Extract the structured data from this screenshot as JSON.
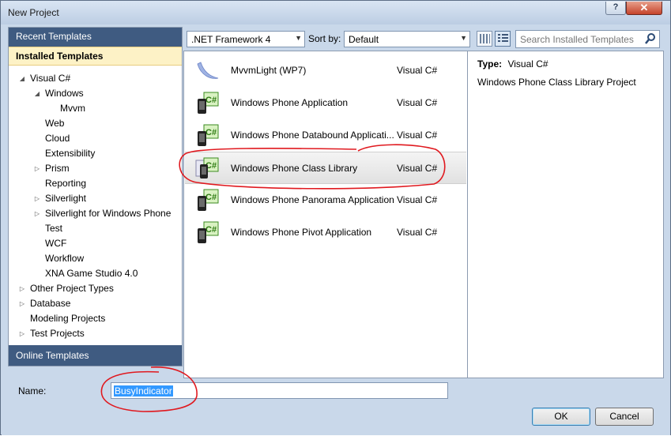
{
  "window": {
    "title": "New Project",
    "help_label": "?",
    "close_label": "✕"
  },
  "left": {
    "recent_templates": "Recent Templates",
    "installed_templates": "Installed Templates",
    "online_templates": "Online Templates",
    "tree": [
      {
        "label": "Visual C#",
        "arrow": "◢"
      },
      {
        "label": "Windows",
        "arrow": "◢"
      },
      {
        "label": "Mvvm",
        "arrow": ""
      },
      {
        "label": "Web",
        "arrow": ""
      },
      {
        "label": "Cloud",
        "arrow": ""
      },
      {
        "label": "Extensibility",
        "arrow": ""
      },
      {
        "label": "Prism",
        "arrow": "▷"
      },
      {
        "label": "Reporting",
        "arrow": ""
      },
      {
        "label": "Silverlight",
        "arrow": "▷"
      },
      {
        "label": "Silverlight for Windows Phone",
        "arrow": "▷"
      },
      {
        "label": "Test",
        "arrow": ""
      },
      {
        "label": "WCF",
        "arrow": ""
      },
      {
        "label": "Workflow",
        "arrow": ""
      },
      {
        "label": "XNA Game Studio 4.0",
        "arrow": ""
      },
      {
        "label": "Other Project Types",
        "arrow": "▷"
      },
      {
        "label": "Database",
        "arrow": "▷"
      },
      {
        "label": "Modeling Projects",
        "arrow": ""
      },
      {
        "label": "Test Projects",
        "arrow": "▷"
      }
    ]
  },
  "toolbar": {
    "framework": ".NET Framework 4",
    "sort_label": "Sort by:",
    "sort_value": "Default",
    "search_placeholder": "Search Installed Templates"
  },
  "templates": [
    {
      "name": "MvvmLight (WP7)",
      "lang": "Visual C#",
      "icon": "mvvmlight-icon"
    },
    {
      "name": "Windows Phone Application",
      "lang": "Visual C#",
      "icon": "phone-csharp-icon"
    },
    {
      "name": "Windows Phone Databound Applicati...",
      "lang": "Visual C#",
      "icon": "phone-csharp-icon"
    },
    {
      "name": "Windows Phone Class Library",
      "lang": "Visual C#",
      "icon": "phone-library-icon"
    },
    {
      "name": "Windows Phone Panorama Application",
      "lang": "Visual C#",
      "icon": "phone-csharp-icon"
    },
    {
      "name": "Windows Phone Pivot Application",
      "lang": "Visual C#",
      "icon": "phone-csharp-icon"
    }
  ],
  "details": {
    "type_label": "Type:",
    "type_value": "Visual C#",
    "description": "Windows Phone Class Library Project"
  },
  "form": {
    "name_label": "Name:",
    "name_value": "BusyIndicator",
    "ok_label": "OK",
    "cancel_label": "Cancel"
  },
  "colors": {
    "header_blue": "#3f5b81",
    "selected_yellow": "#fdf2c6",
    "annotation_red": "#e0191f",
    "text_selection": "#3399ff"
  }
}
